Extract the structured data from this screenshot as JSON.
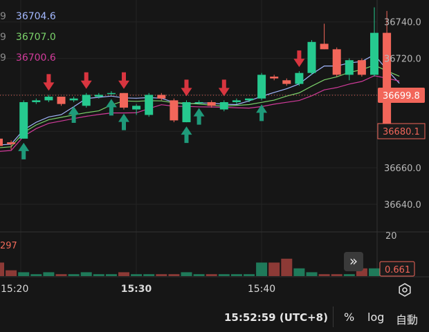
{
  "ma_legend": [
    {
      "period": "9",
      "value": "36704.6",
      "color": "#a3b8ff"
    },
    {
      "period": "9",
      "value": "36707.0",
      "color": "#7bd36b"
    },
    {
      "period": "9",
      "value": "36700.6",
      "color": "#d23b9b"
    }
  ],
  "volume_label": "297",
  "footer": {
    "time": "15:52:59 (UTC+8)",
    "percent_label": "%",
    "log_label": "log",
    "auto_label": "自動"
  },
  "chart_data": {
    "type": "candlestick",
    "price_axis": {
      "ylim": [
        36626,
        36752
      ],
      "ticks": [
        36740.0,
        36720.0,
        36700.0,
        36680.0,
        36660.0,
        36640.0
      ]
    },
    "time_axis": {
      "ticks": [
        "15:20",
        "15:30",
        "15:40"
      ]
    },
    "last_price_label": "36699.8",
    "current_price_label": "36680.1",
    "volume_axis": {
      "ylim": [
        0,
        20
      ],
      "ticks": [
        "20"
      ]
    },
    "volume_indicator_label": "0.661",
    "candles": [
      {
        "o": 36676,
        "h": 36678,
        "l": 36670,
        "c": 36672
      },
      {
        "o": 36674,
        "h": 36675,
        "l": 36670,
        "c": 36673
      },
      {
        "o": 36676,
        "h": 36697,
        "l": 36676,
        "c": 36696
      },
      {
        "o": 36696,
        "h": 36698,
        "l": 36695,
        "c": 36697
      },
      {
        "o": 36697,
        "h": 36700,
        "l": 36696,
        "c": 36699
      },
      {
        "o": 36699,
        "h": 36699,
        "l": 36694,
        "c": 36695
      },
      {
        "o": 36697,
        "h": 36699,
        "l": 36696,
        "c": 36698
      },
      {
        "o": 36694,
        "h": 36701,
        "l": 36693,
        "c": 36700
      },
      {
        "o": 36699,
        "h": 36701,
        "l": 36698,
        "c": 36700
      },
      {
        "o": 36701,
        "h": 36702,
        "l": 36700,
        "c": 36701
      },
      {
        "o": 36701,
        "h": 36701,
        "l": 36692,
        "c": 36693
      },
      {
        "o": 36692,
        "h": 36695,
        "l": 36689,
        "c": 36694
      },
      {
        "o": 36689,
        "h": 36701,
        "l": 36688,
        "c": 36700
      },
      {
        "o": 36700,
        "h": 36701,
        "l": 36697,
        "c": 36698
      },
      {
        "o": 36697,
        "h": 36698,
        "l": 36685,
        "c": 36686
      },
      {
        "o": 36685,
        "h": 36697,
        "l": 36685,
        "c": 36696
      },
      {
        "o": 36696,
        "h": 36697,
        "l": 36695,
        "c": 36696
      },
      {
        "o": 36696,
        "h": 36697,
        "l": 36693,
        "c": 36694
      },
      {
        "o": 36692,
        "h": 36697,
        "l": 36691,
        "c": 36696
      },
      {
        "o": 36696,
        "h": 36698,
        "l": 36695,
        "c": 36697
      },
      {
        "o": 36697,
        "h": 36698,
        "l": 36696,
        "c": 36698
      },
      {
        "o": 36698,
        "h": 36712,
        "l": 36697,
        "c": 36711
      },
      {
        "o": 36710,
        "h": 36711,
        "l": 36708,
        "c": 36709
      },
      {
        "o": 36708,
        "h": 36709,
        "l": 36705,
        "c": 36706
      },
      {
        "o": 36706,
        "h": 36713,
        "l": 36705,
        "c": 36712
      },
      {
        "o": 36712,
        "h": 36730,
        "l": 36711,
        "c": 36729
      },
      {
        "o": 36728,
        "h": 36739,
        "l": 36725,
        "c": 36725
      },
      {
        "o": 36725,
        "h": 36726,
        "l": 36710,
        "c": 36711
      },
      {
        "o": 36711,
        "h": 36720,
        "l": 36708,
        "c": 36719
      },
      {
        "o": 36719,
        "h": 36720,
        "l": 36710,
        "c": 36711
      },
      {
        "o": 36711,
        "h": 36748,
        "l": 36710,
        "c": 36734
      },
      {
        "o": 36734,
        "h": 36746,
        "l": 36678,
        "c": 36680
      },
      {
        "o": 36684,
        "h": 36684,
        "l": 36680,
        "c": 36680
      }
    ],
    "volume": [
      7,
      3,
      2,
      1,
      2,
      1,
      1,
      2,
      1,
      1,
      2,
      1,
      1,
      1,
      1,
      2,
      1,
      1,
      1,
      1,
      1,
      7,
      7,
      9,
      4,
      2,
      1,
      1,
      1,
      4,
      4,
      2,
      1
    ]
  }
}
